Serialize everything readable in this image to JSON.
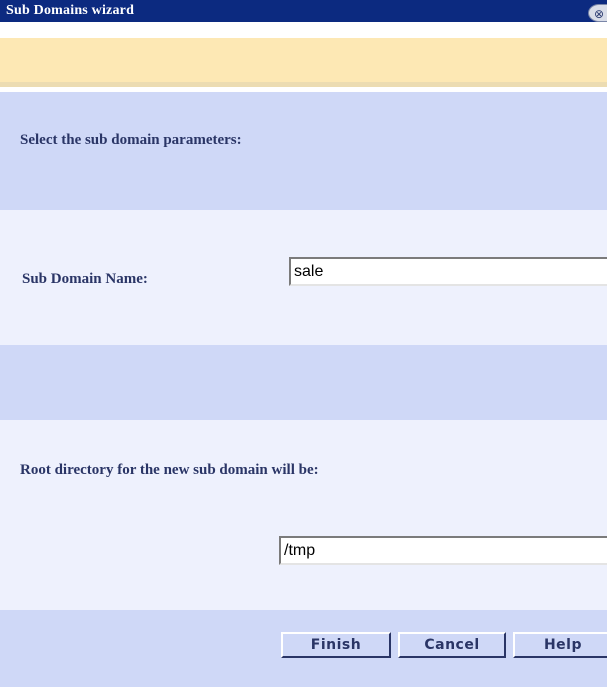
{
  "window": {
    "title": "Sub Domains wizard",
    "close_glyph": "⊗",
    "close_icon": "close-icon"
  },
  "form": {
    "heading": "Select the sub domain parameters:",
    "subdomain_label": "Sub Domain Name:",
    "subdomain_value": "sale",
    "root_dir_label": "Root directory for the new sub domain will be:",
    "root_dir_value": "/tmp"
  },
  "buttons": {
    "finish": "Finish",
    "cancel": "Cancel",
    "help": "Help"
  },
  "colors": {
    "titlebar": "#0c2a80",
    "banner": "#fde8b4",
    "band_dark": "#cfd8f7",
    "band_light": "#eef1fd",
    "label_text": "#2a3566"
  }
}
